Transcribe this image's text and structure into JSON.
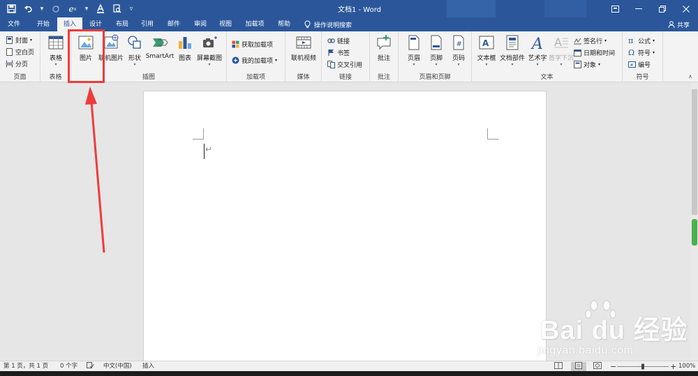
{
  "window": {
    "title": "文档1 - Word",
    "qat": {
      "save_icon": "save-icon",
      "undo_icon": "undo-icon",
      "redo_icon": "redo-icon",
      "equation_icon": "equation-icon",
      "font_color_icon": "font-color-icon",
      "print_preview_icon": "print-preview-icon",
      "customize_icon": "customize-icon"
    }
  },
  "tabs": [
    {
      "label": "文件"
    },
    {
      "label": "开始"
    },
    {
      "label": "插入"
    },
    {
      "label": "设计"
    },
    {
      "label": "布局"
    },
    {
      "label": "引用"
    },
    {
      "label": "邮件"
    },
    {
      "label": "审阅"
    },
    {
      "label": "视图"
    },
    {
      "label": "加载项"
    },
    {
      "label": "帮助"
    }
  ],
  "active_tab": "插入",
  "tell_me": "操作说明搜索",
  "share": "共享",
  "ribbon": {
    "pages": {
      "label": "页面",
      "cover": "封面",
      "blank": "空白页",
      "break": "分页"
    },
    "tables": {
      "label": "表格",
      "table": "表格"
    },
    "illustrations": {
      "label": "插图",
      "pictures": "图片",
      "online_pictures": "联机图片",
      "shapes": "形状",
      "smartart": "SmartArt",
      "chart": "图表",
      "screenshot": "屏幕截图"
    },
    "addins": {
      "label": "加载项",
      "get": "获取加载项",
      "my": "我的加载项"
    },
    "media": {
      "label": "媒体",
      "online_video": "联机视频"
    },
    "links": {
      "label": "链接",
      "link": "链接",
      "bookmark": "书签",
      "cross_ref": "交叉引用"
    },
    "comments": {
      "label": "批注",
      "comment": "批注"
    },
    "header_footer": {
      "label": "页眉和页脚",
      "header": "页眉",
      "footer": "页脚",
      "page_number": "页码"
    },
    "text": {
      "label": "文本",
      "textbox": "文本框",
      "quick_parts": "文档部件",
      "wordart": "艺术字",
      "drop_cap": "首字下沉",
      "signature": "签名行",
      "datetime": "日期和时间",
      "object": "对象"
    },
    "symbols": {
      "label": "符号",
      "equation": "公式",
      "symbol": "符号",
      "numbering": "编号"
    }
  },
  "statusbar": {
    "page": "第 1 页，共 1 页",
    "words": "0 个字",
    "language": "中文(中国)",
    "mode": "插入",
    "zoom": "100%",
    "zoom_level": 1.0
  },
  "watermark": {
    "brand": "Bai du 经验",
    "url": "jingyan.baidu.com"
  },
  "colors": {
    "accent": "#2b579a",
    "annotation": "#ef3b3b"
  }
}
